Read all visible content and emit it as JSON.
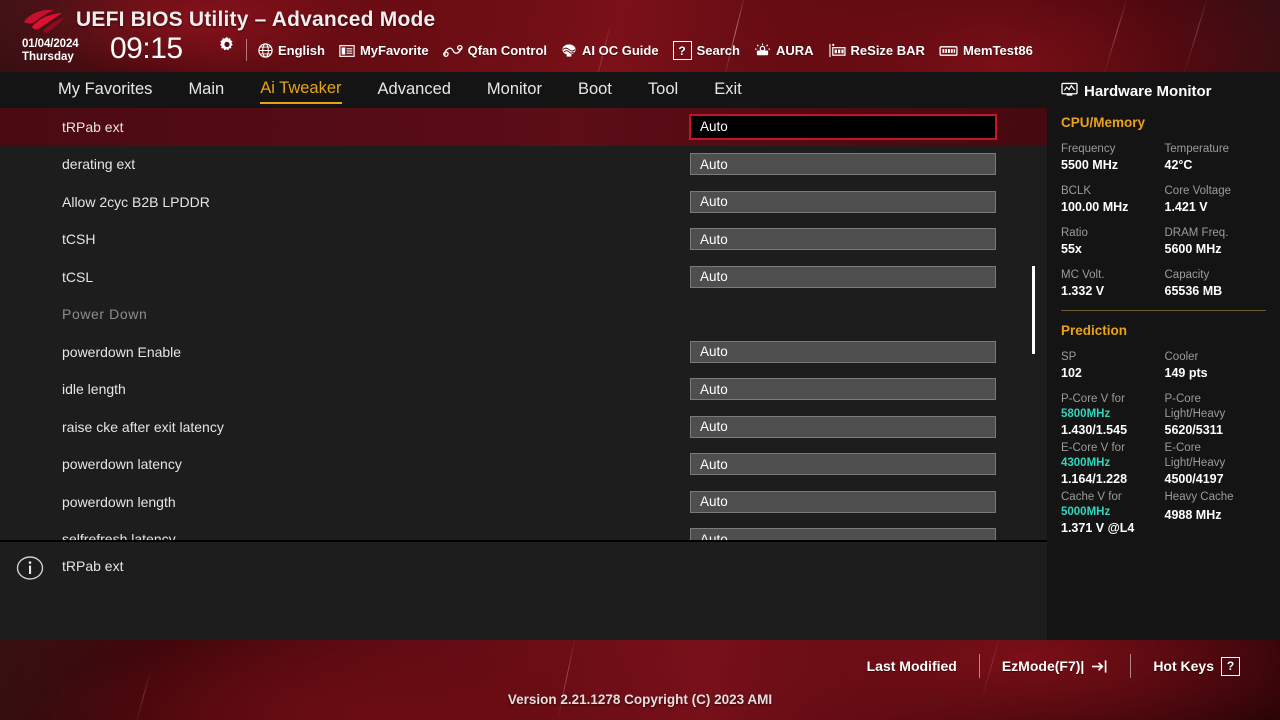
{
  "header": {
    "title": "UEFI BIOS Utility – Advanced Mode",
    "date": "01/04/2024",
    "day": "Thursday",
    "time": "09:15",
    "gear_icon": "gear-icon",
    "logo_icon": "rog-logo-icon",
    "tools": [
      {
        "label": "English",
        "icon": "globe-icon"
      },
      {
        "label": "MyFavorite",
        "icon": "star-list-icon"
      },
      {
        "label": "Qfan Control",
        "icon": "fan-icon"
      },
      {
        "label": "AI OC Guide",
        "icon": "brain-icon"
      },
      {
        "label": "Search",
        "icon": "question-box-icon"
      },
      {
        "label": "AURA",
        "icon": "aura-light-icon"
      },
      {
        "label": "ReSize BAR",
        "icon": "resize-bar-icon"
      },
      {
        "label": "MemTest86",
        "icon": "memtest-icon"
      }
    ]
  },
  "menu": {
    "items": [
      {
        "label": "My Favorites",
        "active": false
      },
      {
        "label": "Main",
        "active": false
      },
      {
        "label": "Ai Tweaker",
        "active": true
      },
      {
        "label": "Advanced",
        "active": false
      },
      {
        "label": "Monitor",
        "active": false
      },
      {
        "label": "Boot",
        "active": false
      },
      {
        "label": "Tool",
        "active": false
      },
      {
        "label": "Exit",
        "active": false
      }
    ],
    "active_color": "#e8a317"
  },
  "settings": {
    "rows": [
      {
        "label": "tRPab ext",
        "value": "Auto",
        "type": "setting",
        "selected": true
      },
      {
        "label": "derating ext",
        "value": "Auto",
        "type": "setting",
        "selected": false
      },
      {
        "label": "Allow 2cyc B2B LPDDR",
        "value": "Auto",
        "type": "setting",
        "selected": false
      },
      {
        "label": "tCSH",
        "value": "Auto",
        "type": "setting",
        "selected": false
      },
      {
        "label": "tCSL",
        "value": "Auto",
        "type": "setting",
        "selected": false
      },
      {
        "label": "Power Down",
        "value": "",
        "type": "section",
        "selected": false
      },
      {
        "label": "powerdown Enable",
        "value": "Auto",
        "type": "setting",
        "selected": false
      },
      {
        "label": "idle length",
        "value": "Auto",
        "type": "setting",
        "selected": false
      },
      {
        "label": "raise cke after exit latency",
        "value": "Auto",
        "type": "setting",
        "selected": false
      },
      {
        "label": "powerdown latency",
        "value": "Auto",
        "type": "setting",
        "selected": false
      },
      {
        "label": "powerdown length",
        "value": "Auto",
        "type": "setting",
        "selected": false
      },
      {
        "label": "selfrefresh latency",
        "value": "Auto",
        "type": "setting",
        "selected": false
      }
    ]
  },
  "infobar": {
    "icon": "info-icon",
    "text": "tRPab ext"
  },
  "hardware_monitor": {
    "title": "Hardware Monitor",
    "title_icon": "monitor-icon",
    "sections": [
      {
        "name": "CPU/Memory",
        "pairs": [
          [
            {
              "key": "Frequency",
              "value": "5500 MHz"
            },
            {
              "key": "Temperature",
              "value": "42°C"
            }
          ],
          [
            {
              "key": "BCLK",
              "value": "100.00 MHz"
            },
            {
              "key": "Core Voltage",
              "value": "1.421 V"
            }
          ],
          [
            {
              "key": "Ratio",
              "value": "55x"
            },
            {
              "key": "DRAM Freq.",
              "value": "5600 MHz"
            }
          ],
          [
            {
              "key": "MC Volt.",
              "value": "1.332 V"
            },
            {
              "key": "Capacity",
              "value": "65536 MB"
            }
          ]
        ]
      },
      {
        "name": "Prediction",
        "pairs": [
          [
            {
              "key": "SP",
              "value": "102"
            },
            {
              "key": "Cooler",
              "value": "149 pts"
            }
          ]
        ],
        "triples": [
          {
            "left_key": "P-Core V for",
            "left_accent": "5800MHz",
            "left_value": "1.430/1.545",
            "right_key": "P-Core",
            "right_key2": "Light/Heavy",
            "right_value": "5620/5311"
          },
          {
            "left_key": "E-Core V for",
            "left_accent": "4300MHz",
            "left_value": "1.164/1.228",
            "right_key": "E-Core",
            "right_key2": "Light/Heavy",
            "right_value": "4500/4197"
          },
          {
            "left_key": "Cache V for",
            "left_accent": "5000MHz",
            "left_value": "1.371 V @L4",
            "right_key": "Heavy Cache",
            "right_key2": "",
            "right_value": "4988 MHz"
          }
        ]
      }
    ],
    "accent_color": "#e8a317",
    "highlight_color": "#2fd6bd"
  },
  "footer": {
    "last_modified": "Last Modified",
    "ezmode": "EzMode(F7)|",
    "hotkeys": "Hot Keys",
    "hotkeys_key": "?",
    "version": "Version 2.21.1278 Copyright (C) 2023 AMI"
  }
}
